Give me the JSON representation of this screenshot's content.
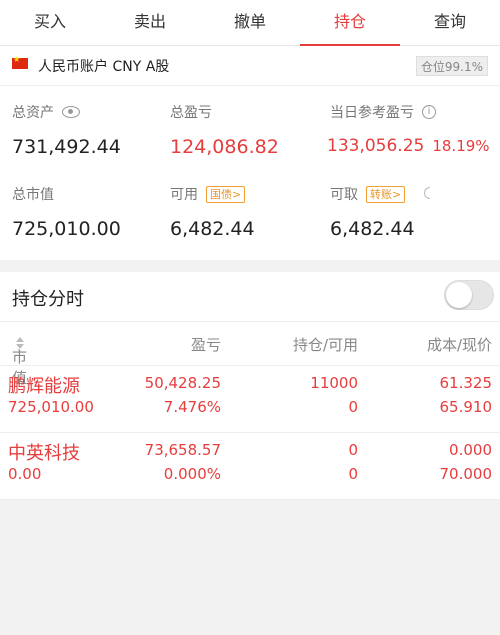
{
  "tabs": [
    {
      "label": "买入"
    },
    {
      "label": "卖出"
    },
    {
      "label": "撤单"
    },
    {
      "label": "持仓"
    },
    {
      "label": "查询"
    }
  ],
  "active_tab": "持仓",
  "account": {
    "flag_icon": "china-flag-icon",
    "name": "人民币账户 CNY A股",
    "position_ratio": "仓位99.1%"
  },
  "summary": {
    "total_assets": {
      "label": "总资产",
      "value": "731,492.44",
      "icon": "eye-icon"
    },
    "total_pnl": {
      "label": "总盈亏",
      "value": "124,086.82"
    },
    "today_pnl": {
      "label": "当日参考盈亏",
      "value": "133,056.25",
      "pct": "18.19%",
      "icon": "info-icon"
    },
    "market_value": {
      "label": "总市值",
      "value": "725,010.00"
    },
    "available": {
      "label": "可用",
      "value": "6,482.44",
      "tag": "国债>"
    },
    "withdrawable": {
      "label": "可取",
      "value": "6,482.44",
      "tag": "转账>"
    }
  },
  "positions_panel": {
    "title": "持仓分时",
    "toggle_on": false,
    "headers": {
      "market_value": "市值",
      "pnl": "盈亏",
      "holding": "持仓/可用",
      "cost_price": "成本/现价"
    },
    "rows": [
      {
        "name": "鹏辉能源",
        "market_value": "725,010.00",
        "pnl": "50,428.25",
        "pnl_pct": "7.476%",
        "holding": "11000",
        "available": "0",
        "cost": "61.325",
        "price": "65.910"
      },
      {
        "name": "中英科技",
        "market_value": "0.00",
        "pnl": "73,658.57",
        "pnl_pct": "0.000%",
        "holding": "0",
        "available": "0",
        "cost": "0.000",
        "price": "70.000"
      }
    ]
  },
  "colors": {
    "accent_red": "#e63d3d",
    "tag_orange": "#e8962a",
    "background": "#f2f2f2"
  }
}
